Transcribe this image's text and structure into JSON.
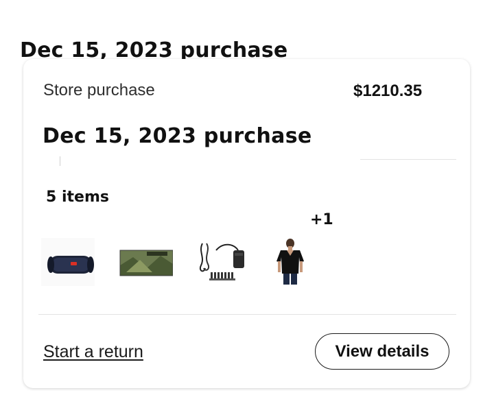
{
  "order": {
    "header_title": "Dec 15, 2023 purchase",
    "purchase_type": "Store purchase",
    "total": "$1210.35",
    "card_title": "Dec 15, 2023 purchase",
    "items_count_label": "5 items",
    "more_items_label": "+1",
    "items": [
      {
        "icon": "bluetooth-speaker-icon"
      },
      {
        "icon": "wall-art-icon"
      },
      {
        "icon": "power-adapter-icon"
      },
      {
        "icon": "black-tshirt-icon"
      }
    ],
    "actions": {
      "return_label": "Start a return",
      "details_label": "View details"
    }
  },
  "colors": {
    "text": "#111111",
    "secondary_text": "#2e2e2e",
    "divider": "#e3e3e3",
    "border": "#1a1a1a"
  }
}
